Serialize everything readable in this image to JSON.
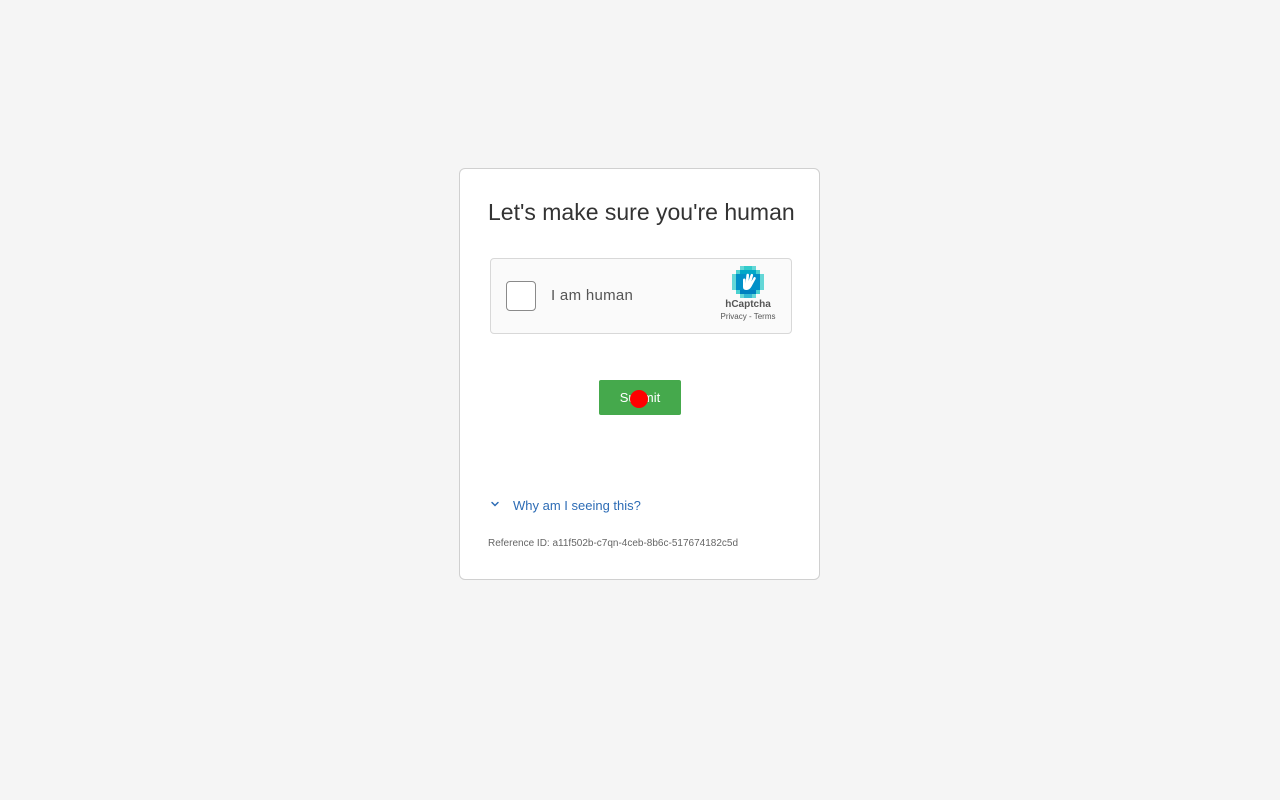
{
  "page": {
    "title": "Let's make sure you're human",
    "submit_label": "Submit",
    "why_link": "Why am I seeing this?",
    "reference_label": "Reference ID:",
    "reference_id": "a11f502b-c7qn-4ceb-8b6c-517674182c5d"
  },
  "captcha": {
    "label": "I am human",
    "brand": "hCaptcha",
    "privacy_link": "Privacy",
    "separator": "-",
    "terms_link": "Terms",
    "logo_icon": "hcaptcha-hand-icon",
    "checked": false
  },
  "colors": {
    "background": "#f5f5f5",
    "submit_button": "#45a94c",
    "link": "#2d6cb5",
    "logo_primary": "#0074bf",
    "logo_secondary": "#00bfbf",
    "cursor_marker": "#ff0000"
  }
}
